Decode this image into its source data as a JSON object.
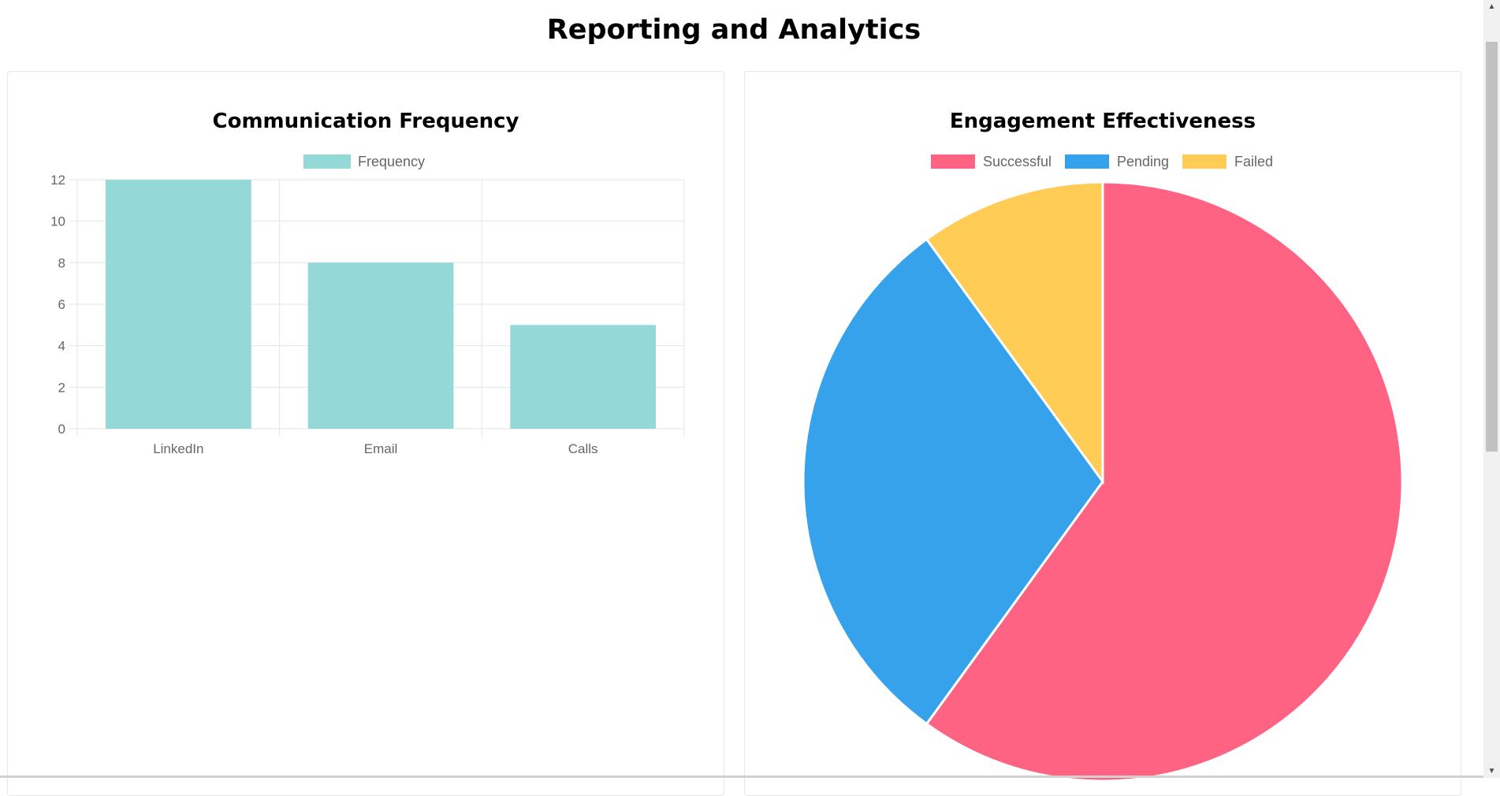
{
  "page": {
    "title": "Reporting and Analytics"
  },
  "colors": {
    "bar_fill": "#94d9d8",
    "grid": "#e5e5e5",
    "successful": "#ff6384",
    "pending": "#36a2eb",
    "failed": "#ffcd56"
  },
  "icons": {
    "scroll_up": "▲",
    "scroll_down": "▼"
  },
  "chart_data": [
    {
      "type": "bar",
      "title": "Communication Frequency",
      "categories": [
        "LinkedIn",
        "Email",
        "Calls"
      ],
      "series": [
        {
          "name": "Frequency",
          "values": [
            12,
            8,
            5
          ]
        }
      ],
      "ylim": [
        0,
        12
      ],
      "yticks": [
        0,
        2,
        4,
        6,
        8,
        10,
        12
      ],
      "grid": true,
      "legend": "top-center"
    },
    {
      "type": "pie",
      "title": "Engagement Effectiveness",
      "labels": [
        "Successful",
        "Pending",
        "Failed"
      ],
      "values": [
        60,
        30,
        10
      ],
      "legend": "top-center"
    }
  ]
}
